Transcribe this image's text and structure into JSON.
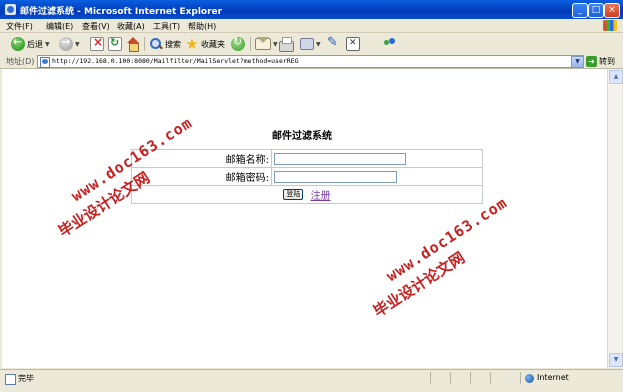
{
  "window": {
    "title": "邮件过滤系统 - Microsoft Internet Explorer"
  },
  "menu": [
    "文件(F)",
    "编辑(E)",
    "查看(V)",
    "收藏(A)",
    "工具(T)",
    "帮助(H)"
  ],
  "toolbar": {
    "back_label": "后退",
    "search_label": "搜索",
    "favorites_label": "收藏夹"
  },
  "address": {
    "label": "地址(D)",
    "url": "http://192.168.0.100:8080/Mailfilter/MailServlet?method=userREG",
    "go_label": "转到"
  },
  "page": {
    "title": "邮件过滤系统",
    "username_label": "邮箱名称:",
    "password_label": "邮箱密码:",
    "username_value": "",
    "password_value": "",
    "login_button": "登陆",
    "register_link": "注册"
  },
  "watermarks": {
    "cn_text": "毕业设计论文网",
    "en_text": "www.doc163.com"
  },
  "status": {
    "text": "完毕",
    "zone": "Internet"
  }
}
